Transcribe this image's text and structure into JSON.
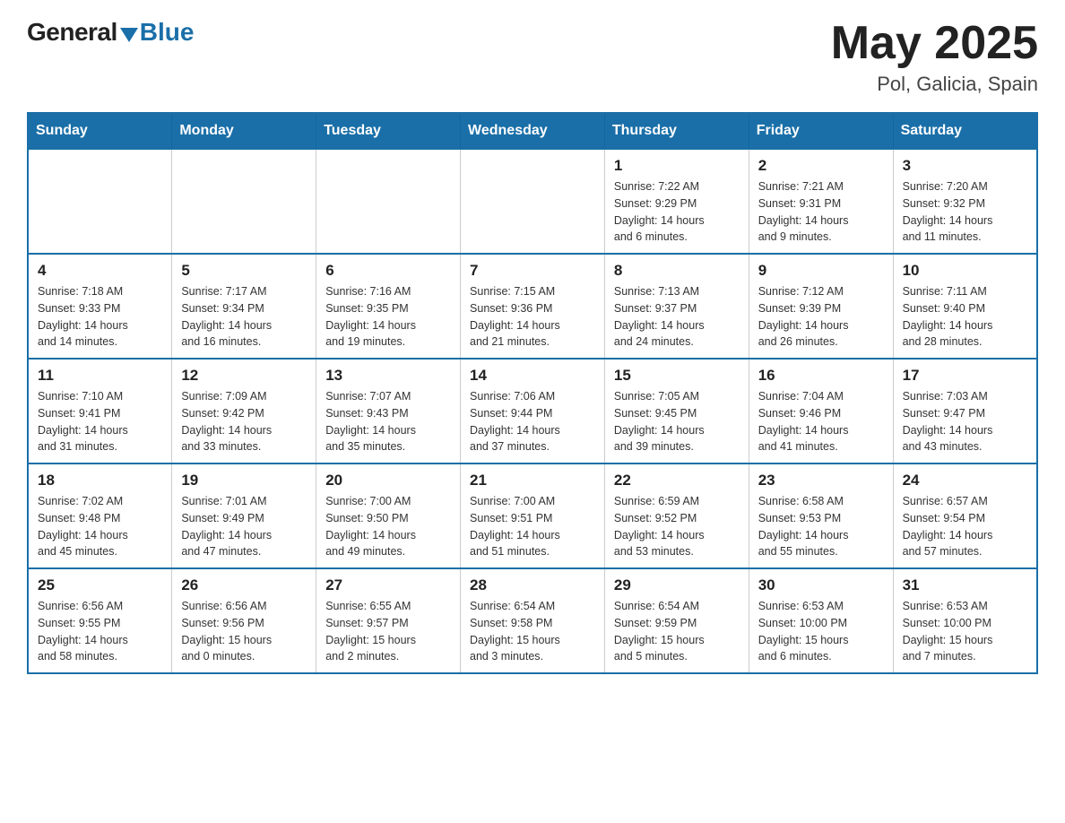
{
  "header": {
    "logo_general": "General",
    "logo_blue": "Blue",
    "title": "May 2025",
    "location": "Pol, Galicia, Spain"
  },
  "weekdays": [
    "Sunday",
    "Monday",
    "Tuesday",
    "Wednesday",
    "Thursday",
    "Friday",
    "Saturday"
  ],
  "weeks": [
    [
      {
        "day": "",
        "info": ""
      },
      {
        "day": "",
        "info": ""
      },
      {
        "day": "",
        "info": ""
      },
      {
        "day": "",
        "info": ""
      },
      {
        "day": "1",
        "info": "Sunrise: 7:22 AM\nSunset: 9:29 PM\nDaylight: 14 hours\nand 6 minutes."
      },
      {
        "day": "2",
        "info": "Sunrise: 7:21 AM\nSunset: 9:31 PM\nDaylight: 14 hours\nand 9 minutes."
      },
      {
        "day": "3",
        "info": "Sunrise: 7:20 AM\nSunset: 9:32 PM\nDaylight: 14 hours\nand 11 minutes."
      }
    ],
    [
      {
        "day": "4",
        "info": "Sunrise: 7:18 AM\nSunset: 9:33 PM\nDaylight: 14 hours\nand 14 minutes."
      },
      {
        "day": "5",
        "info": "Sunrise: 7:17 AM\nSunset: 9:34 PM\nDaylight: 14 hours\nand 16 minutes."
      },
      {
        "day": "6",
        "info": "Sunrise: 7:16 AM\nSunset: 9:35 PM\nDaylight: 14 hours\nand 19 minutes."
      },
      {
        "day": "7",
        "info": "Sunrise: 7:15 AM\nSunset: 9:36 PM\nDaylight: 14 hours\nand 21 minutes."
      },
      {
        "day": "8",
        "info": "Sunrise: 7:13 AM\nSunset: 9:37 PM\nDaylight: 14 hours\nand 24 minutes."
      },
      {
        "day": "9",
        "info": "Sunrise: 7:12 AM\nSunset: 9:39 PM\nDaylight: 14 hours\nand 26 minutes."
      },
      {
        "day": "10",
        "info": "Sunrise: 7:11 AM\nSunset: 9:40 PM\nDaylight: 14 hours\nand 28 minutes."
      }
    ],
    [
      {
        "day": "11",
        "info": "Sunrise: 7:10 AM\nSunset: 9:41 PM\nDaylight: 14 hours\nand 31 minutes."
      },
      {
        "day": "12",
        "info": "Sunrise: 7:09 AM\nSunset: 9:42 PM\nDaylight: 14 hours\nand 33 minutes."
      },
      {
        "day": "13",
        "info": "Sunrise: 7:07 AM\nSunset: 9:43 PM\nDaylight: 14 hours\nand 35 minutes."
      },
      {
        "day": "14",
        "info": "Sunrise: 7:06 AM\nSunset: 9:44 PM\nDaylight: 14 hours\nand 37 minutes."
      },
      {
        "day": "15",
        "info": "Sunrise: 7:05 AM\nSunset: 9:45 PM\nDaylight: 14 hours\nand 39 minutes."
      },
      {
        "day": "16",
        "info": "Sunrise: 7:04 AM\nSunset: 9:46 PM\nDaylight: 14 hours\nand 41 minutes."
      },
      {
        "day": "17",
        "info": "Sunrise: 7:03 AM\nSunset: 9:47 PM\nDaylight: 14 hours\nand 43 minutes."
      }
    ],
    [
      {
        "day": "18",
        "info": "Sunrise: 7:02 AM\nSunset: 9:48 PM\nDaylight: 14 hours\nand 45 minutes."
      },
      {
        "day": "19",
        "info": "Sunrise: 7:01 AM\nSunset: 9:49 PM\nDaylight: 14 hours\nand 47 minutes."
      },
      {
        "day": "20",
        "info": "Sunrise: 7:00 AM\nSunset: 9:50 PM\nDaylight: 14 hours\nand 49 minutes."
      },
      {
        "day": "21",
        "info": "Sunrise: 7:00 AM\nSunset: 9:51 PM\nDaylight: 14 hours\nand 51 minutes."
      },
      {
        "day": "22",
        "info": "Sunrise: 6:59 AM\nSunset: 9:52 PM\nDaylight: 14 hours\nand 53 minutes."
      },
      {
        "day": "23",
        "info": "Sunrise: 6:58 AM\nSunset: 9:53 PM\nDaylight: 14 hours\nand 55 minutes."
      },
      {
        "day": "24",
        "info": "Sunrise: 6:57 AM\nSunset: 9:54 PM\nDaylight: 14 hours\nand 57 minutes."
      }
    ],
    [
      {
        "day": "25",
        "info": "Sunrise: 6:56 AM\nSunset: 9:55 PM\nDaylight: 14 hours\nand 58 minutes."
      },
      {
        "day": "26",
        "info": "Sunrise: 6:56 AM\nSunset: 9:56 PM\nDaylight: 15 hours\nand 0 minutes."
      },
      {
        "day": "27",
        "info": "Sunrise: 6:55 AM\nSunset: 9:57 PM\nDaylight: 15 hours\nand 2 minutes."
      },
      {
        "day": "28",
        "info": "Sunrise: 6:54 AM\nSunset: 9:58 PM\nDaylight: 15 hours\nand 3 minutes."
      },
      {
        "day": "29",
        "info": "Sunrise: 6:54 AM\nSunset: 9:59 PM\nDaylight: 15 hours\nand 5 minutes."
      },
      {
        "day": "30",
        "info": "Sunrise: 6:53 AM\nSunset: 10:00 PM\nDaylight: 15 hours\nand 6 minutes."
      },
      {
        "day": "31",
        "info": "Sunrise: 6:53 AM\nSunset: 10:00 PM\nDaylight: 15 hours\nand 7 minutes."
      }
    ]
  ]
}
